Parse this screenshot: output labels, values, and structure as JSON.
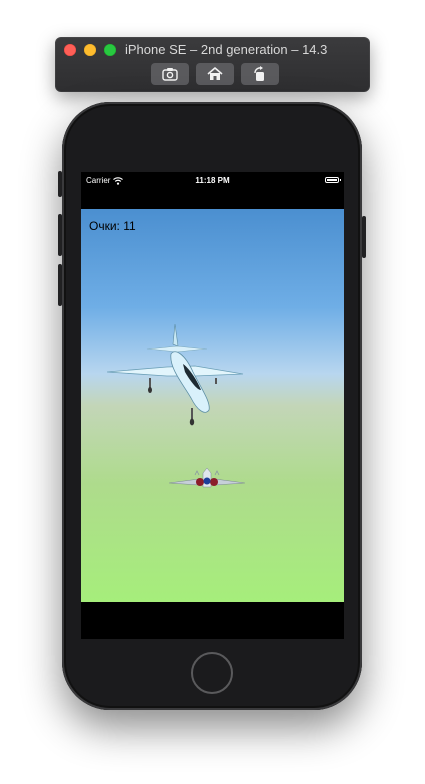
{
  "simulator": {
    "title": "iPhone SE – 2nd generation – 14.3",
    "buttons": [
      {
        "name": "screenshot",
        "icon": "camera-icon"
      },
      {
        "name": "home",
        "icon": "home-icon"
      },
      {
        "name": "rotate",
        "icon": "rotate-icon"
      }
    ]
  },
  "status_bar": {
    "carrier": "Carrier",
    "time": "11:18 PM",
    "battery_level": 1.0
  },
  "game": {
    "score_label": "Очки: 11",
    "sky_color_top": "#4b8fd0",
    "ground_color_bottom": "#a6ee7b"
  },
  "colors": {
    "close": "#ff5f57",
    "minimize": "#febc2e",
    "zoom": "#28c840"
  }
}
